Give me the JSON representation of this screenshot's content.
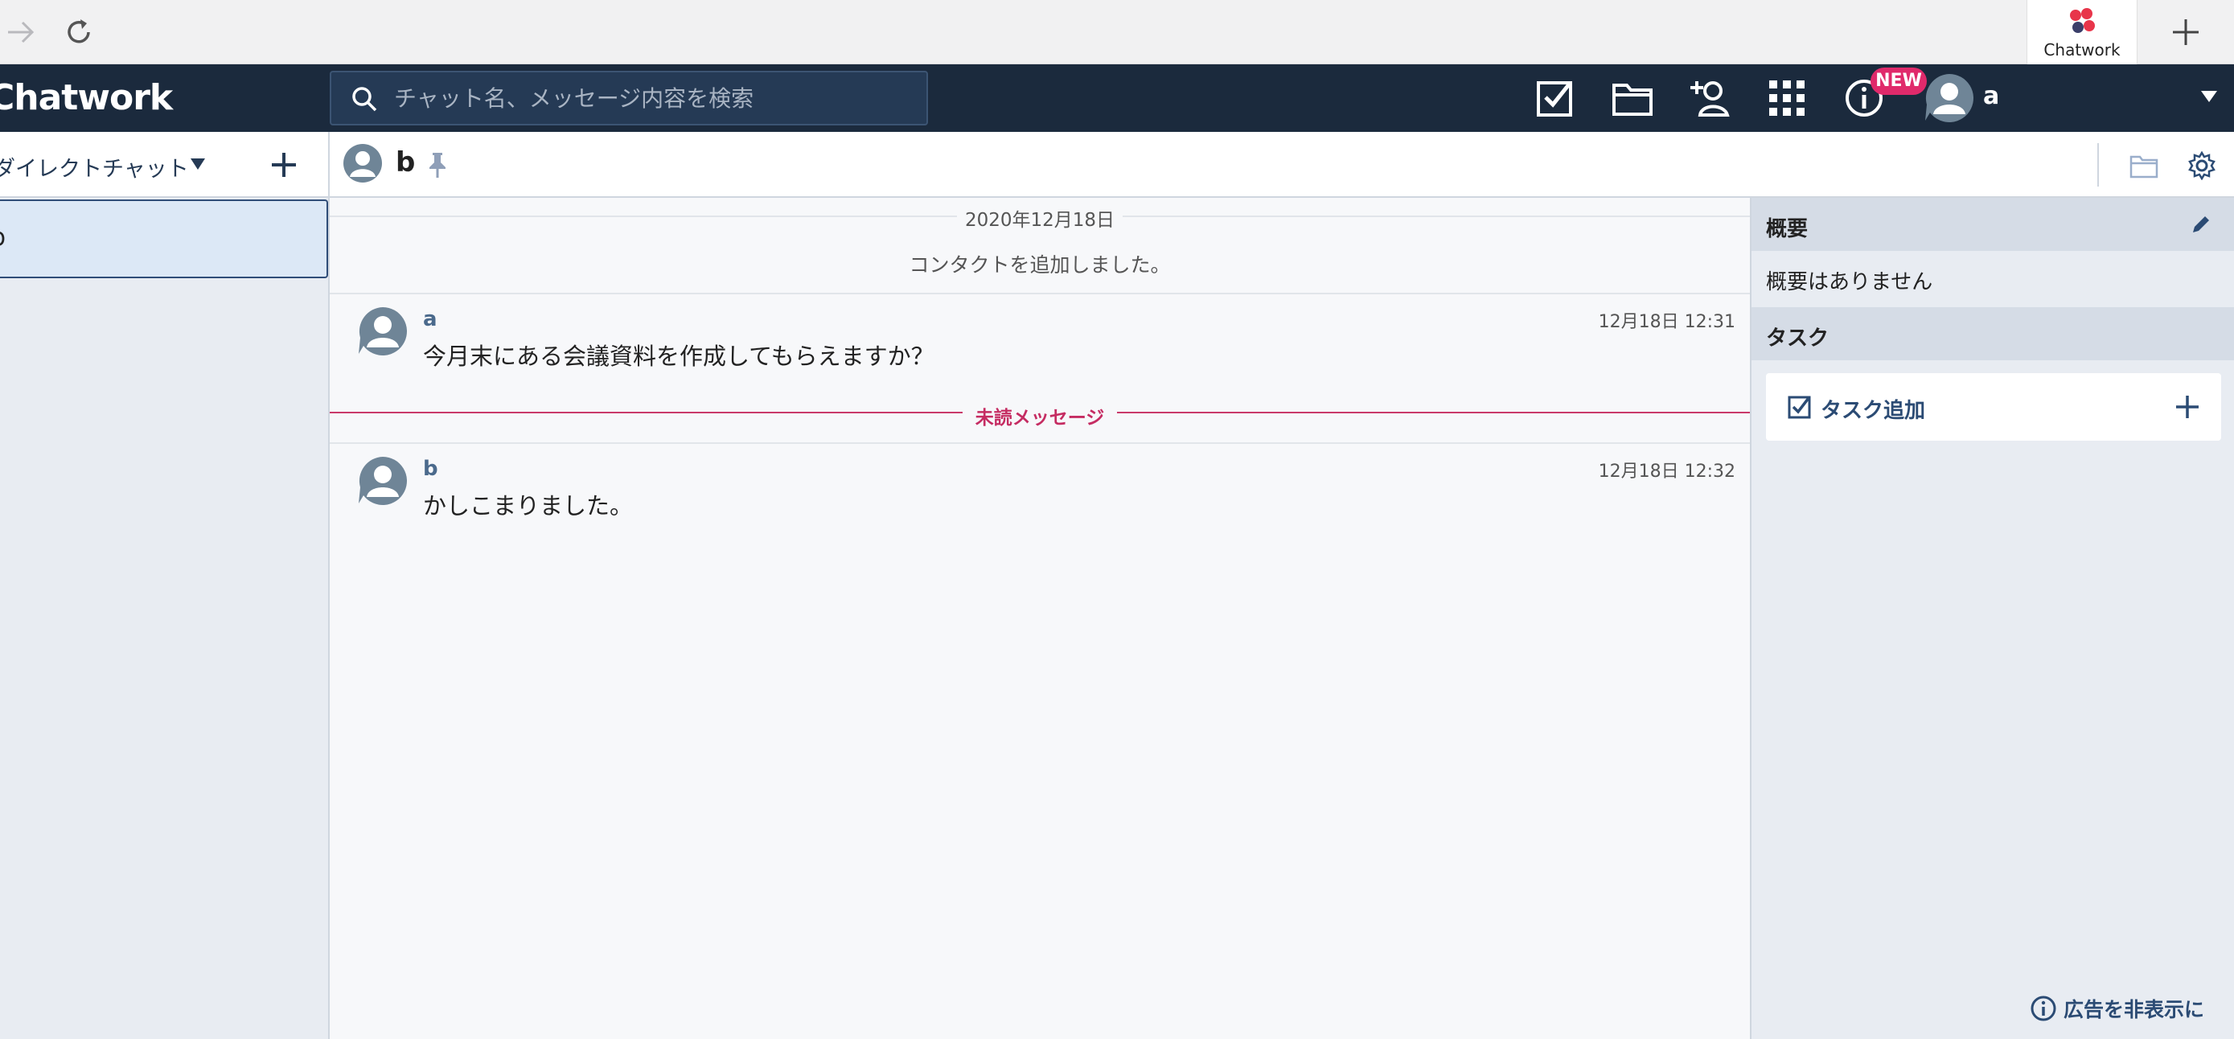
{
  "browser": {
    "tab_label": "Chatwork"
  },
  "header": {
    "logo_text": "Chatwork",
    "search_placeholder": "チャット名、メッセージ内容を検索",
    "new_badge": "NEW",
    "user_name": "a"
  },
  "sidebar": {
    "filter_label": "ダイレクトチャット",
    "rooms": [
      {
        "name": "b"
      }
    ]
  },
  "chat": {
    "room_title": "b",
    "date_label": "2020年12月18日",
    "system_message": "コンタクトを追加しました。",
    "unread_label": "未読メッセージ",
    "messages": [
      {
        "sender": "a",
        "time": "12月18日 12:31",
        "text": "今月末にある会議資料を作成してもらえますか？"
      },
      {
        "sender": "b",
        "time": "12月18日 12:32",
        "text": "かしこまりました。"
      }
    ]
  },
  "right_panel": {
    "overview_title": "概要",
    "overview_body": "概要はありません",
    "task_title": "タスク",
    "add_task_label": "タスク追加",
    "hide_ads_label": "広告を非表示に"
  },
  "colors": {
    "header_bg": "#1b2a3d",
    "accent": "#2b4b74",
    "unread": "#c52c62",
    "badge": "#e02a6b"
  }
}
